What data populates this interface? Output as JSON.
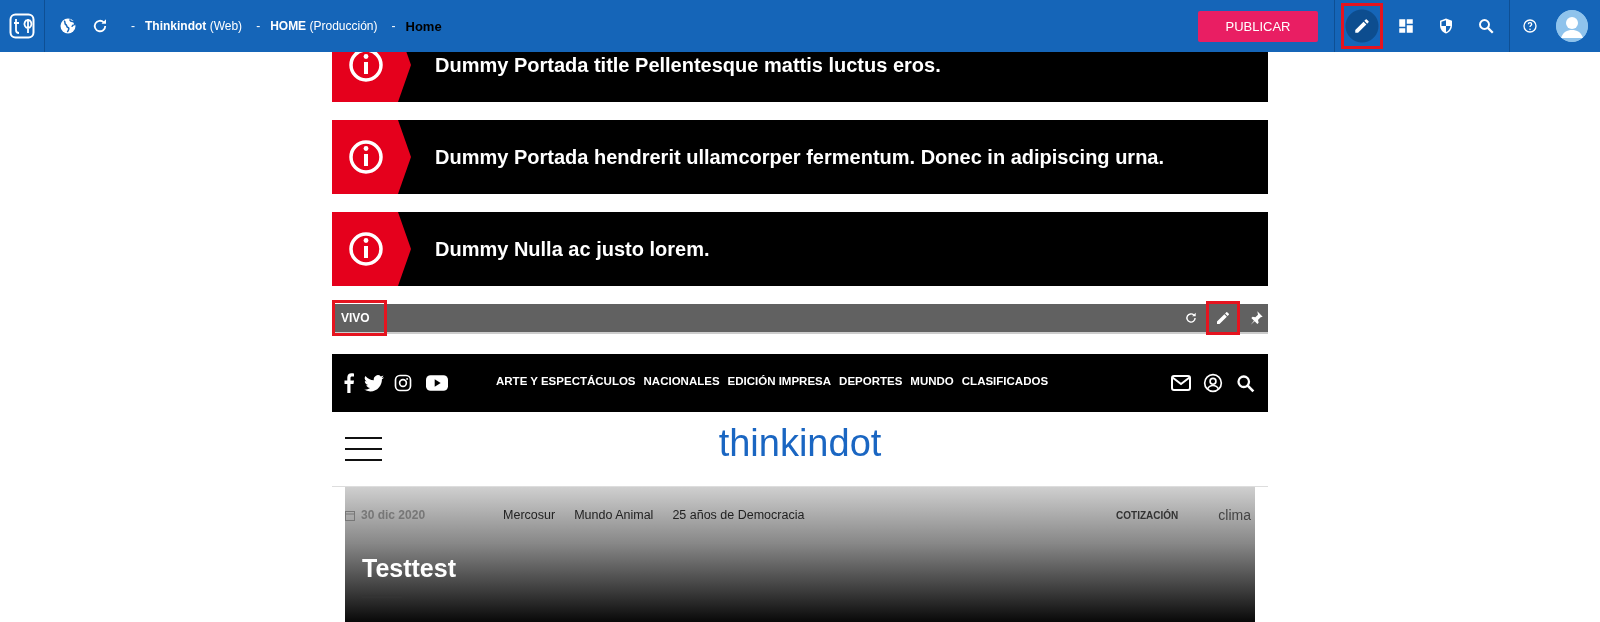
{
  "topbar": {
    "breadcrumb": [
      {
        "strong": "Thinkindot",
        "light": "(Web)"
      },
      {
        "strong": "HOME",
        "light": "(Producción)"
      }
    ],
    "separator": "-",
    "page": "Home",
    "publish": "PUBLICAR",
    "tools": [
      {
        "kind": "edit",
        "selected": true,
        "highlighted": true
      },
      {
        "kind": "layout",
        "selected": false,
        "highlighted": false
      },
      {
        "kind": "shield",
        "selected": false,
        "highlighted": false
      },
      {
        "kind": "search",
        "selected": false,
        "highlighted": false
      }
    ]
  },
  "alerts": [
    {
      "text": "Dummy Portada title Pellentesque mattis luctus eros."
    },
    {
      "text": "Dummy Portada hendrerit ullamcorper fermentum. Donec in adipiscing urna."
    },
    {
      "text": "Dummy Nulla ac justo lorem."
    }
  ],
  "live_bar": {
    "label": "VIVO",
    "label_highlighted": true,
    "edit_highlighted": true
  },
  "site_nav": {
    "menu": [
      "ARTE Y ESPECTÁCULOS",
      "NACIONALES",
      "EDICIÓN IMPRESA",
      "DEPORTES",
      "MUNDO",
      "CLASIFICADOS"
    ]
  },
  "masthead": {
    "logo": "thinkindot"
  },
  "hero": {
    "date": "30 dic 2020",
    "links": [
      "Mercosur",
      "Mundo Animal",
      "25 años de Democracia"
    ],
    "quote_label": "COTIZACIÓN",
    "weather_alt": "clima",
    "title": "Testtest"
  }
}
